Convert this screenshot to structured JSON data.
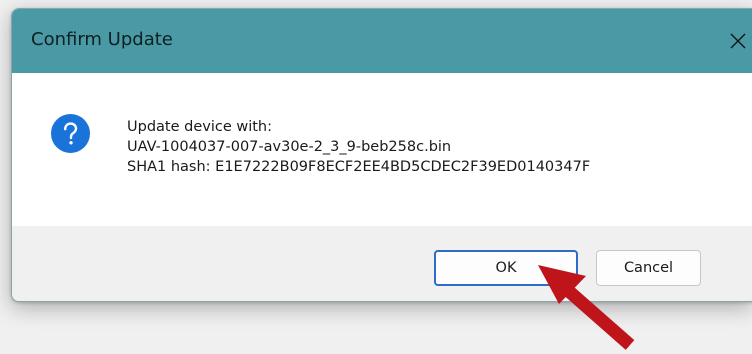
{
  "dialog": {
    "title": "Confirm Update",
    "close_glyph": "✕",
    "icon": "question-icon",
    "message_lines": [
      "Update device with:",
      "UAV-1004037-007-av30e-2_3_9-beb258c.bin",
      "SHA1 hash: E1E7222B09F8ECF2EE4BD5CDEC2F39ED0140347F"
    ],
    "ok_label": "OK",
    "cancel_label": "Cancel"
  },
  "colors": {
    "titlebar": "#4a9aa6",
    "icon_blue": "#1a73d9",
    "ok_border": "#2f6cc7",
    "arrow": "#c0141b"
  }
}
